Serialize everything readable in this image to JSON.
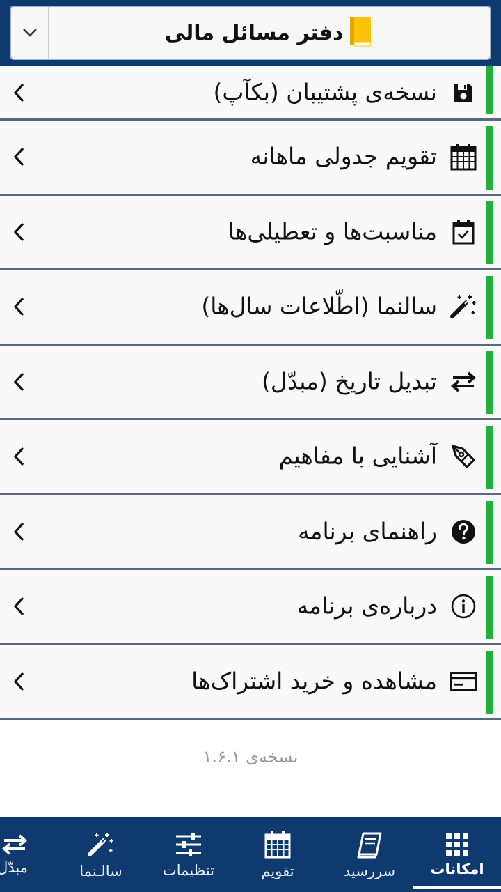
{
  "header": {
    "book_title": "دفتر مسائل مالی",
    "dropdown_icon": "chevron-down-icon",
    "book_icon": "book-icon",
    "accent_color": "#ffc107"
  },
  "menu": {
    "items": [
      {
        "label": "نسخه‌ی پشتیبان (بکآپ)",
        "icon": "save-icon"
      },
      {
        "label": "تقویم جدولی ماهانه",
        "icon": "calendar-grid-icon"
      },
      {
        "label": "مناسبت‌ها و تعطیلی‌ها",
        "icon": "calendar-check-icon"
      },
      {
        "label": "سالنما (اطّلاعات سال‌ها)",
        "icon": "magic-wand-icon"
      },
      {
        "label": "تبدیل تاریخ (مبدّل)",
        "icon": "swap-arrows-icon"
      },
      {
        "label": "آشنایی با مفاهیم",
        "icon": "pen-nib-icon"
      },
      {
        "label": "راهنمای برنامه",
        "icon": "help-circle-icon"
      },
      {
        "label": "درباره‌ی برنامه",
        "icon": "info-circle-icon"
      },
      {
        "label": "مشاهده و خرید اشتراک‌ها",
        "icon": "credit-card-icon"
      }
    ],
    "accent_color": "#22b03c"
  },
  "version_text": "نسخه‌ی ۱.۶.۱",
  "bottom_nav": {
    "items": [
      {
        "label": "امکانات",
        "icon": "apps-grid-icon",
        "active": true
      },
      {
        "label": "سررسید",
        "icon": "notebook-icon",
        "active": false
      },
      {
        "label": "تقویم",
        "icon": "calendar-icon",
        "active": false
      },
      {
        "label": "تنظیمات",
        "icon": "sliders-icon",
        "active": false
      },
      {
        "label": "سالـنما",
        "icon": "magic-wand-icon",
        "active": false
      },
      {
        "label": "مبدّل",
        "icon": "swap-arrows-icon",
        "active": false
      }
    ],
    "background": "#0e3a70"
  }
}
